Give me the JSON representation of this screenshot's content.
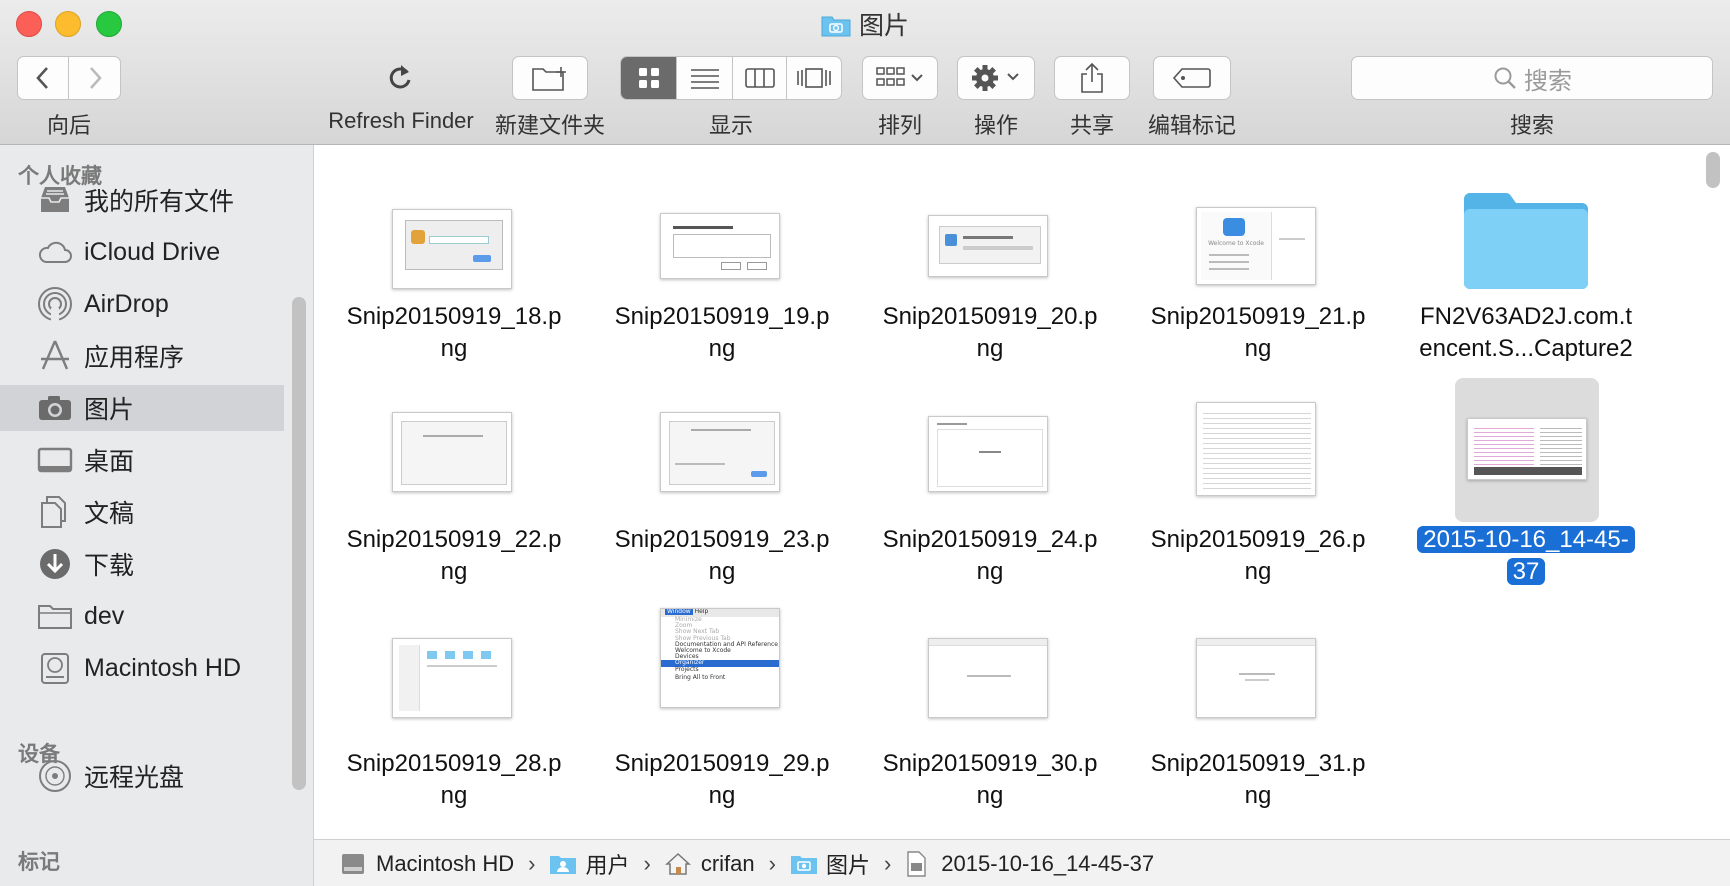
{
  "window": {
    "title": "图片"
  },
  "toolbar": {
    "back_label": "向后",
    "refresh_label": "Refresh Finder",
    "new_folder_label": "新建文件夹",
    "view_label": "显示",
    "arrange_label": "排列",
    "action_label": "操作",
    "share_label": "共享",
    "tags_label": "编辑标记",
    "search_placeholder": "搜索",
    "search_label": "搜索"
  },
  "sidebar": {
    "favorites_header": "个人收藏",
    "items": [
      {
        "label": "我的所有文件",
        "icon": "all-files-icon"
      },
      {
        "label": "iCloud Drive",
        "icon": "cloud-icon"
      },
      {
        "label": "AirDrop",
        "icon": "airdrop-icon"
      },
      {
        "label": "应用程序",
        "icon": "applications-icon"
      },
      {
        "label": "图片",
        "icon": "camera-icon",
        "selected": true
      },
      {
        "label": "桌面",
        "icon": "desktop-icon"
      },
      {
        "label": "文稿",
        "icon": "documents-icon"
      },
      {
        "label": "下载",
        "icon": "download-icon"
      },
      {
        "label": "dev",
        "icon": "folder-icon"
      },
      {
        "label": "Macintosh HD",
        "icon": "hard-drive-icon"
      }
    ],
    "devices_header": "设备",
    "device_items": [
      {
        "label": "远程光盘",
        "icon": "disc-icon"
      }
    ],
    "tags_header": "标记"
  },
  "files": [
    {
      "line1": "Snip20150919_18.p",
      "line2": "ng"
    },
    {
      "line1": "Snip20150919_19.p",
      "line2": "ng"
    },
    {
      "line1": "Snip20150919_20.p",
      "line2": "ng"
    },
    {
      "line1": "Snip20150919_21.p",
      "line2": "ng"
    },
    {
      "line1": "FN2V63AD2J.com.t",
      "line2": "encent.S...Capture2",
      "kind": "folder"
    },
    {
      "line1": "Snip20150919_22.p",
      "line2": "ng"
    },
    {
      "line1": "Snip20150919_23.p",
      "line2": "ng"
    },
    {
      "line1": "Snip20150919_24.p",
      "line2": "ng"
    },
    {
      "line1": "Snip20150919_26.p",
      "line2": "ng"
    },
    {
      "line1": "2015-10-16_14-45-",
      "line2": "37",
      "selected": true
    },
    {
      "line1": "Snip20150919_28.p",
      "line2": "ng"
    },
    {
      "line1": "Snip20150919_29.p",
      "line2": "ng"
    },
    {
      "line1": "Snip20150919_30.p",
      "line2": "ng"
    },
    {
      "line1": "Snip20150919_31.p",
      "line2": "ng"
    }
  ],
  "thumb_text": {
    "xcode_welcome": "Welcome to Xcode",
    "menu_window": "Window",
    "menu_help": "Help",
    "menu_items": [
      "Minimize",
      "Zoom",
      "Show Next Tab",
      "Show Previous Tab",
      "Documentation and API Reference",
      "Welcome to Xcode",
      "Devices",
      "Organizer",
      "Projects",
      "Bring All to Front"
    ]
  },
  "pathbar": {
    "crumbs": [
      "Macintosh HD",
      "用户",
      "crifan",
      "图片",
      "2015-10-16_14-45-37"
    ]
  },
  "colors": {
    "selection": "#1a6fd7",
    "folder": "#6cc3f0",
    "sidebar_bg": "#e9eaec"
  }
}
